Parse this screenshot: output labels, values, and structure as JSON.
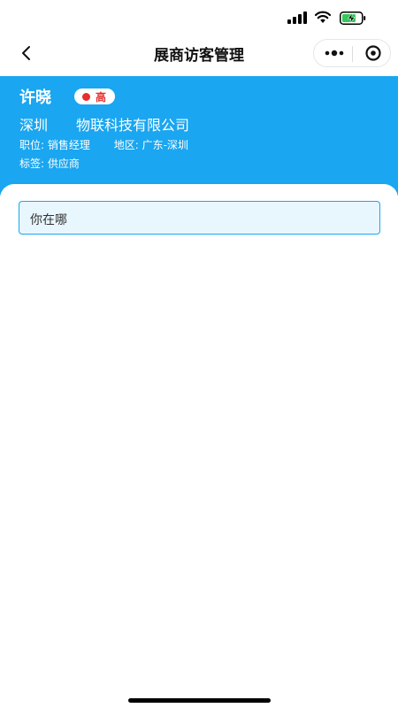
{
  "nav": {
    "title": "展商访客管理"
  },
  "visitor": {
    "name": "许晓",
    "level": "高",
    "company": "深圳　　物联科技有限公司",
    "position_label": "职位:",
    "position": "销售经理",
    "region_label": "地区:",
    "region": "广东-深圳",
    "tag_label": "标签:",
    "tag": "供应商"
  },
  "message": {
    "text": "你在哪"
  },
  "colors": {
    "primary": "#1aa6f0",
    "level_high": "#e62e2e",
    "message_bg": "#e8f6fd"
  },
  "icons": {
    "back": "chevron-left-icon",
    "more": "more-dots-icon",
    "close": "target-close-icon"
  }
}
